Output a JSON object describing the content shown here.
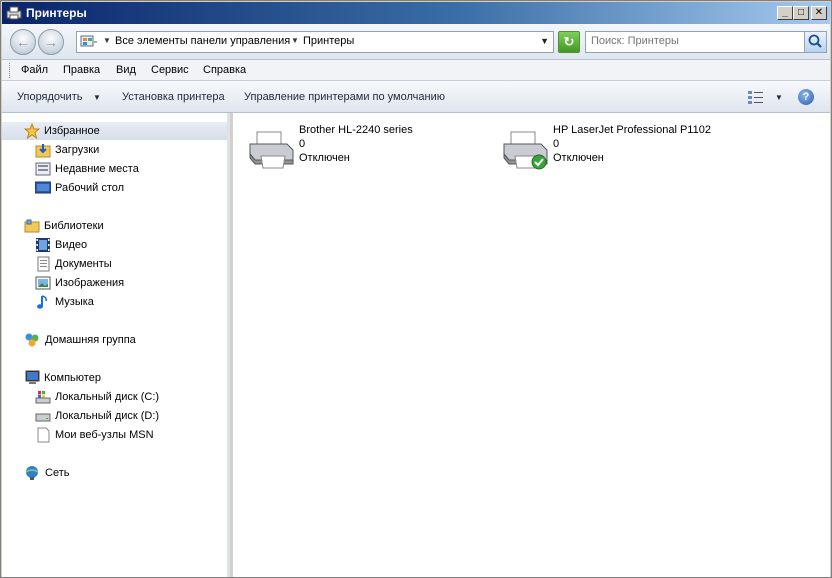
{
  "window": {
    "title": "Принтеры",
    "min_label": "_",
    "max_label": "□",
    "close_label": "✕"
  },
  "address_bar": {
    "crumbs": [
      "Все элементы панели управления",
      "Принтеры"
    ],
    "search_placeholder": "Поиск: Принтеры"
  },
  "menu": [
    "Файл",
    "Правка",
    "Вид",
    "Сервис",
    "Справка"
  ],
  "commands": {
    "organize": "Упорядочить",
    "add_printer": "Установка принтера",
    "manage_default": "Управление принтерами по умолчанию",
    "help": "?"
  },
  "sidebar": {
    "favorites": {
      "label": "Избранное",
      "items": [
        "Загрузки",
        "Недавние места",
        "Рабочий стол"
      ]
    },
    "libraries": {
      "label": "Библиотеки",
      "items": [
        "Видео",
        "Документы",
        "Изображения",
        "Музыка"
      ]
    },
    "homegroup": "Домашняя группа",
    "computer": {
      "label": "Компьютер",
      "items": [
        "Локальный диск (C:)",
        "Локальный диск (D:)",
        "Мои веб-узлы MSN"
      ]
    },
    "network": "Сеть"
  },
  "printers": [
    {
      "name": "Brother HL-2240 series",
      "jobs": "0",
      "status": "Отключен",
      "default": false
    },
    {
      "name": "HP LaserJet Professional P1102",
      "jobs": "0",
      "status": "Отключен",
      "default": true
    }
  ],
  "colors": {
    "title_gradient_start": "#0a246a",
    "title_gradient_end": "#a6caf0",
    "accent": "#3a6ea5"
  }
}
